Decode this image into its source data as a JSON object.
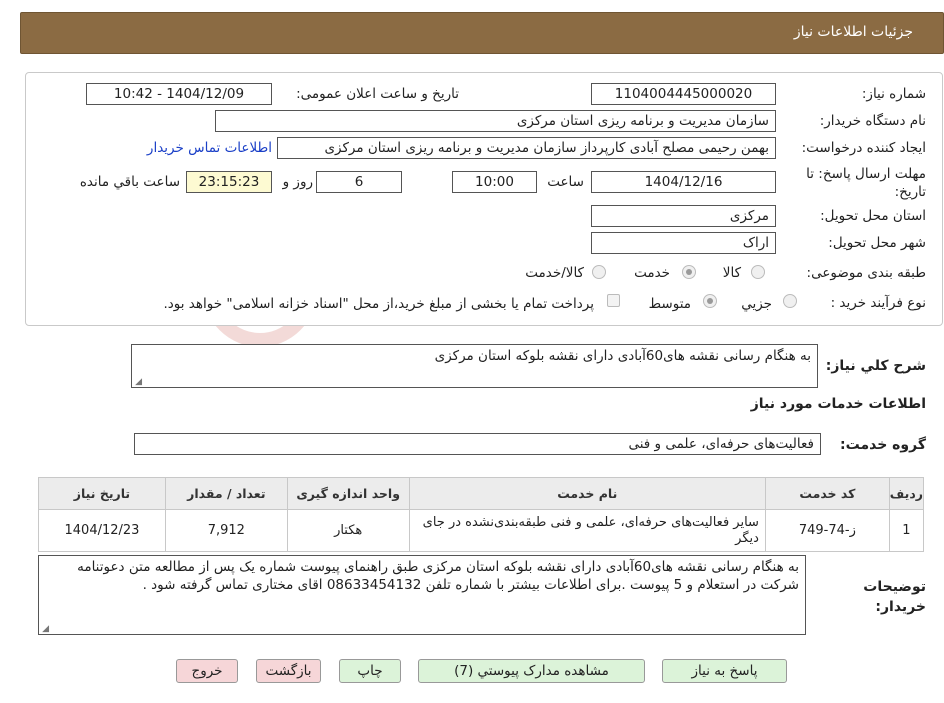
{
  "header": {
    "title": "جزئیات اطلاعات نیاز"
  },
  "fields": {
    "need_number_label": "شماره نیاز:",
    "need_number": "1104004445000020",
    "announce_label": "تاریخ و ساعت اعلان عمومی:",
    "announce_value": "1404/12/09 - 10:42",
    "buyer_org_label": "نام دستگاه خریدار:",
    "buyer_org": "سازمان مدیریت و برنامه ریزی استان مرکزی",
    "requester_label": "ایجاد کننده درخواست:",
    "requester": "بهمن رحیمی مصلح آبادی کارپرداز سازمان مدیریت و برنامه ریزی استان مرکزی",
    "contact_link": "اطلاعات تماس خریدار",
    "deadline_label": "مهلت ارسال پاسخ: تا تاریخ:",
    "deadline_date": "1404/12/16",
    "time_label": "ساعت",
    "deadline_time": "10:00",
    "days_value": "6",
    "days_label": "روز و",
    "remaining_time": "23:15:23",
    "remaining_label": "ساعت باقي مانده",
    "province_label": "استان محل تحویل:",
    "province": "مرکزی",
    "city_label": "شهر محل تحویل:",
    "city": "اراک",
    "category_label": "طبقه بندی موضوعی:",
    "category_options": [
      "کالا",
      "خدمت",
      "کالا/خدمت"
    ],
    "category_selected": "خدمت",
    "process_label": "نوع فرآیند خرید :",
    "process_options": [
      "جزیي",
      "متوسط"
    ],
    "process_selected": "جزیي",
    "payment_note": "پرداخت تمام یا بخشی از مبلغ خرید،از محل \"اسناد خزانه اسلامی\" خواهد بود."
  },
  "summary": {
    "label": "شرح کلي نیاز:",
    "text": "به هنگام رسانی نقشه های60آبادی دارای نقشه  بلوکه استان مرکزی"
  },
  "services": {
    "title": "اطلاعات خدمات مورد نیاز",
    "group_label": "گروه خدمت:",
    "group_value": "فعالیت‌های حرفه‌ای، علمی و فنی",
    "columns": [
      "ردیف",
      "کد خدمت",
      "نام خدمت",
      "واحد اندازه گیری",
      "تعداد / مقدار",
      "تاریخ نیاز"
    ],
    "rows": [
      [
        "1",
        "ز-74-749",
        "سایر فعالیت‌های حرفه‌ای، علمی و فنی طبقه‌بندی‌نشده در جای دیگر",
        "هکتار",
        "7,912",
        "1404/12/23"
      ]
    ]
  },
  "buyer_notes": {
    "label": "توضیحات خریدار:",
    "text": "به هنگام رسانی نقشه های60آبادی دارای نقشه  بلوکه استان مرکزی طبق راهنمای پیوست شماره یک پس از مطالعه متن دعوتنامه شرکت در استعلام و 5 پیوست .برای اطلاعات بیشتر با شماره تلفن 08633454132 اقای  مختاری تماس گرفته شود ."
  },
  "buttons": {
    "reply": "پاسخ به نیاز",
    "attachments": "مشاهده مدارک پیوستي (7)",
    "print": "چاپ",
    "back": "بازگشت",
    "exit": "خروج"
  },
  "watermark": {
    "text": "AriaTender.neT"
  },
  "colors": {
    "header": "#8b6b43",
    "link": "#1a3fc7",
    "highlight": "#fdfad2",
    "green_button": "#dcf3d9",
    "pink_button": "#f6d6d8"
  }
}
